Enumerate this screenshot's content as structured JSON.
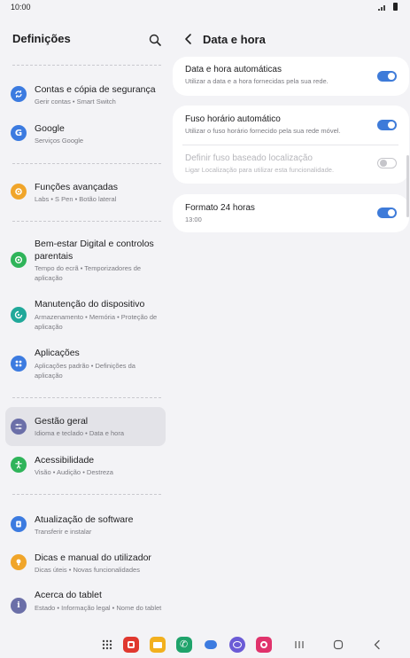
{
  "status": {
    "time": "10:00"
  },
  "left": {
    "title": "Definições",
    "items": [
      {
        "title": "Contas e cópia de segurança",
        "subtitle": "Gerir contas • Smart Switch",
        "icon": "sync-icon",
        "color": "#3c7be0"
      },
      {
        "title": "Google",
        "subtitle": "Serviços Google",
        "icon": "google-icon",
        "color": "#3c7be0"
      },
      {
        "title": "Funções avançadas",
        "subtitle": "Labs • S Pen • Botão lateral",
        "icon": "gear-plus-icon",
        "color": "#f0a52a"
      },
      {
        "title": "Bem-estar Digital e controlos parentais",
        "subtitle": "Tempo do ecrã • Temporizadores de aplicação",
        "icon": "wellbeing-icon",
        "color": "#2fb45a"
      },
      {
        "title": "Manutenção do dispositivo",
        "subtitle": "Armazenamento • Memória • Proteção de aplicação",
        "icon": "device-care-icon",
        "color": "#20a89a"
      },
      {
        "title": "Aplicações",
        "subtitle": "Aplicações padrão • Definições da aplicação",
        "icon": "apps-icon",
        "color": "#3c7be0"
      },
      {
        "title": "Gestão geral",
        "subtitle": "Idioma e teclado • Data e hora",
        "icon": "sliders-icon",
        "color": "#6b6fa8"
      },
      {
        "title": "Acessibilidade",
        "subtitle": "Visão • Audição • Destreza",
        "icon": "accessibility-icon",
        "color": "#2fb45a"
      },
      {
        "title": "Atualização de software",
        "subtitle": "Transferir e instalar",
        "icon": "update-icon",
        "color": "#3c7be0"
      },
      {
        "title": "Dicas e manual do utilizador",
        "subtitle": "Dicas úteis • Novas funcionalidades",
        "icon": "bulb-icon",
        "color": "#f0a52a"
      },
      {
        "title": "Acerca do tablet",
        "subtitle": "Estado • Informação legal • Nome do tablet",
        "icon": "info-icon",
        "color": "#6b6fa8"
      }
    ]
  },
  "right": {
    "title": "Data e hora",
    "rows": [
      {
        "title": "Data e hora automáticas",
        "subtitle": "Utilizar a data e a hora fornecidas pela sua rede.",
        "toggle": true
      },
      {
        "title": "Fuso horário automático",
        "subtitle": "Utilizar o fuso horário fornecido pela sua rede móvel.",
        "toggle": true
      },
      {
        "title": "Definir fuso baseado localização",
        "subtitle": "Ligar Localização para utilizar esta funcionalidade.",
        "toggle": false
      },
      {
        "title": "Formato 24 horas",
        "subtitle": "13:00",
        "toggle": true
      }
    ]
  },
  "navbar": {
    "apps": [
      {
        "name": "apps-drawer-icon",
        "color": "#444444"
      },
      {
        "name": "app-red-icon",
        "color": "#e0382f"
      },
      {
        "name": "my-files-icon",
        "color": "#f2b01e"
      },
      {
        "name": "phone-icon",
        "color": "#1fa36b"
      },
      {
        "name": "messages-icon",
        "color": "#3c7be0"
      },
      {
        "name": "internet-icon",
        "color": "#6b5bd6"
      },
      {
        "name": "camera-icon",
        "color": "#e0336c"
      }
    ]
  }
}
